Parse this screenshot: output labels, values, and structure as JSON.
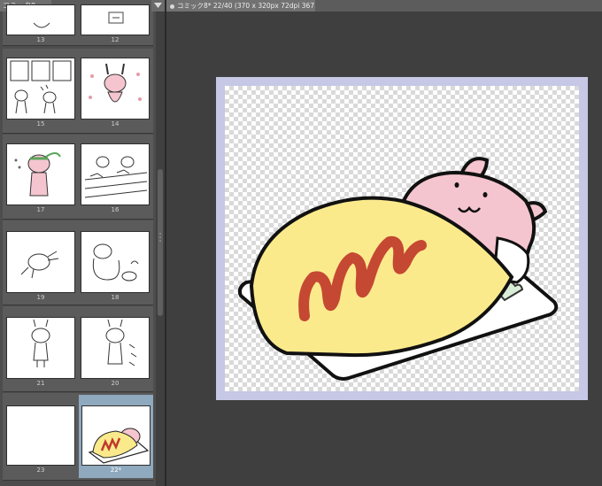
{
  "left_panel": {
    "tab_label": "コミック8",
    "spreads": [
      {
        "left_page": "13",
        "right_page": "12"
      },
      {
        "left_page": "15",
        "right_page": "14"
      },
      {
        "left_page": "17",
        "right_page": "16"
      },
      {
        "left_page": "19",
        "right_page": "18"
      },
      {
        "left_page": "21",
        "right_page": "20"
      },
      {
        "left_page": "23",
        "right_page": "22*"
      }
    ]
  },
  "document_tab": {
    "label": "コミック8* 22/40 (370 x 320px 72dpi 367.1%)"
  },
  "colors": {
    "panel_bg": "#4d4d4d",
    "canvas_bg": "#3f3f3f",
    "page_frame": "#c6c8e6",
    "selected_page": "#8fa9be",
    "rabbit_pink": "#f5c5cf",
    "omelette_yellow": "#fbea8c",
    "ketchup": "#c0392b"
  }
}
